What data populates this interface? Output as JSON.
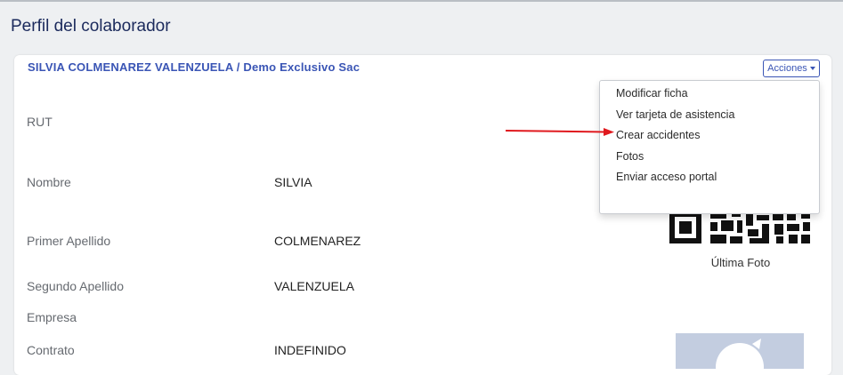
{
  "page": {
    "title": "Perfil del colaborador"
  },
  "card": {
    "header": "SILVIA COLMENAREZ VALENZUELA / Demo Exclusivo Sac",
    "actions_label": "Acciones"
  },
  "fields": [
    {
      "label": "RUT",
      "value": ""
    },
    {
      "label": "Nombre",
      "value": "SILVIA"
    },
    {
      "label": "Primer Apellido",
      "value": "COLMENAREZ"
    },
    {
      "label": "Segundo Apellido",
      "value": "VALENZUELA"
    },
    {
      "label": "Empresa",
      "value": ""
    },
    {
      "label": "Contrato",
      "value": "INDEFINIDO"
    }
  ],
  "menu": {
    "items": [
      "Modificar ficha",
      "Ver tarjeta de asistencia",
      "Crear accidentes",
      "Fotos",
      "Enviar acceso portal"
    ]
  },
  "photo": {
    "caption": "Última Foto"
  },
  "colors": {
    "accent": "#3a55b5",
    "title": "#1b2a5c",
    "arrow": "#e0191e",
    "background": "#eef0f2"
  },
  "icons": {
    "caret": "chevron-down-icon",
    "qr": "qr-code-icon",
    "arrow": "red-arrow-annotation"
  }
}
